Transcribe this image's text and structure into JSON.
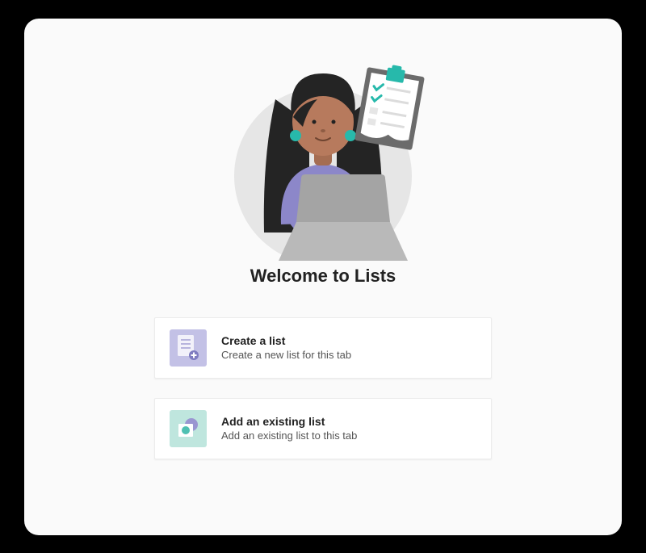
{
  "header": {
    "title": "Welcome to Lists"
  },
  "actions": {
    "create": {
      "title": "Create a list",
      "subtitle": "Create a new list for this tab"
    },
    "add_existing": {
      "title": "Add an existing list",
      "subtitle": "Add an existing list to this tab"
    }
  },
  "colors": {
    "accent_purple": "#7e7bc0",
    "accent_teal": "#27b9ab"
  }
}
